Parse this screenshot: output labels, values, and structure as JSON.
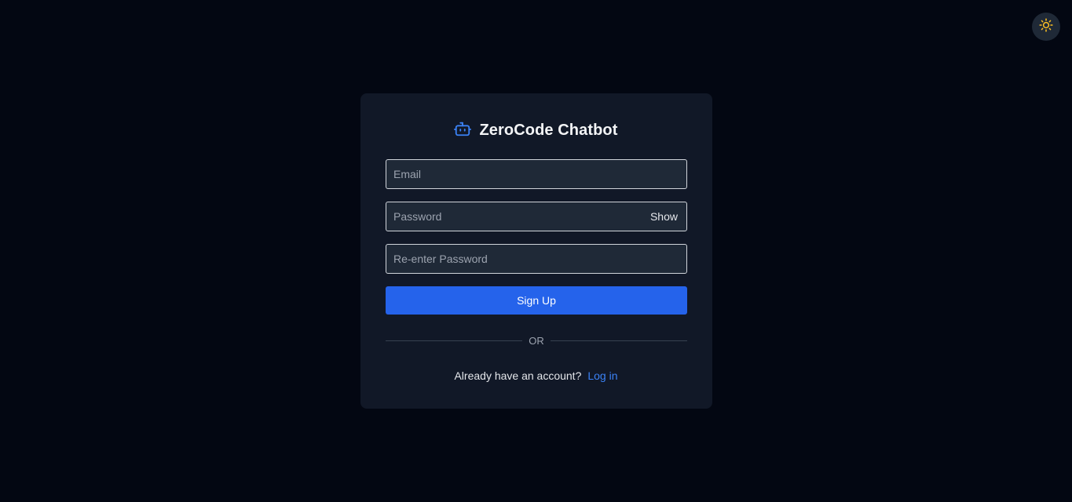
{
  "app": {
    "title": "ZeroCode Chatbot",
    "brand_icon": "robot-icon",
    "accent_color": "#3b82f6"
  },
  "theme_toggle": {
    "icon": "sun-icon",
    "icon_color": "#fbbf24"
  },
  "form": {
    "email": {
      "placeholder": "Email",
      "value": ""
    },
    "password": {
      "placeholder": "Password",
      "value": "",
      "toggle_label": "Show"
    },
    "confirm_password": {
      "placeholder": "Re-enter Password",
      "value": ""
    },
    "submit_label": "Sign Up",
    "submit_color": "#2563eb"
  },
  "divider": {
    "label": "OR"
  },
  "footer": {
    "prompt": "Already have an account?",
    "link_label": "Log in"
  }
}
